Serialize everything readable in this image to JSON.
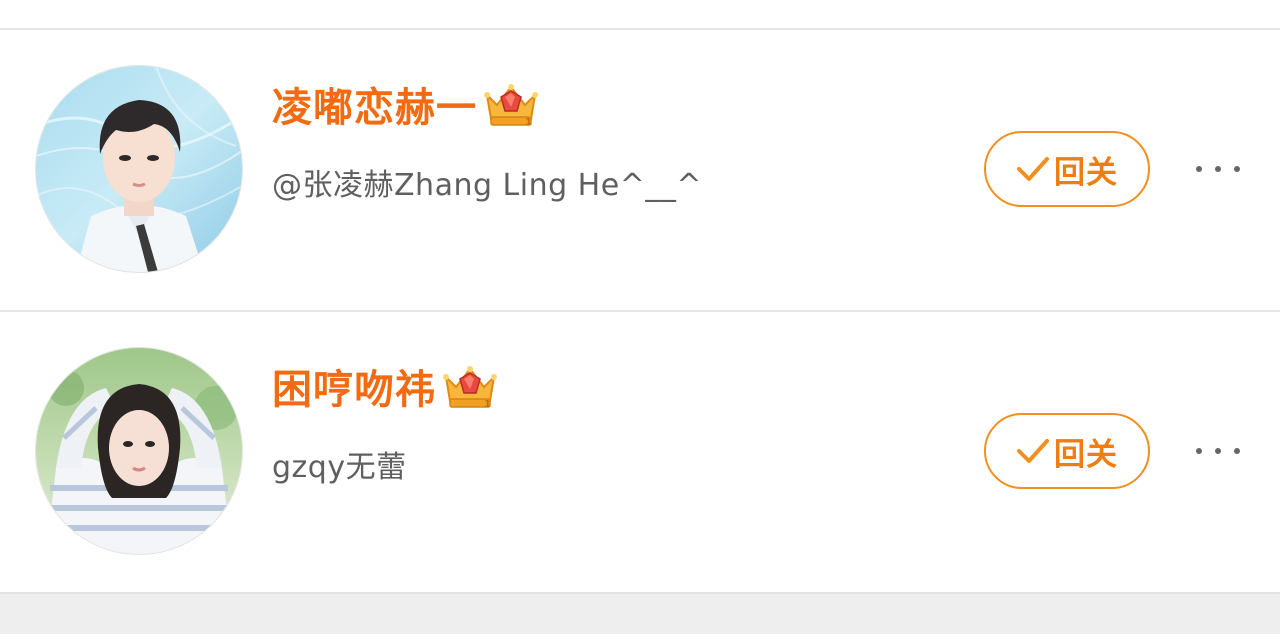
{
  "users": [
    {
      "name": "凌嘟恋赫一",
      "subtitle": "@张凌赫Zhang Ling He^__^",
      "follow_label": "回关",
      "badge_icon": "crown-ruby-icon"
    },
    {
      "name": "困哼吻祎",
      "subtitle": "gzqy无蕾",
      "follow_label": "回关",
      "badge_icon": "crown-ruby-icon"
    }
  ],
  "colors": {
    "name": "#f26a11",
    "follow_border": "#f2901f",
    "follow_text": "#f07d10",
    "subtitle": "#5f5f5f",
    "divider": "#e6e6e6"
  }
}
